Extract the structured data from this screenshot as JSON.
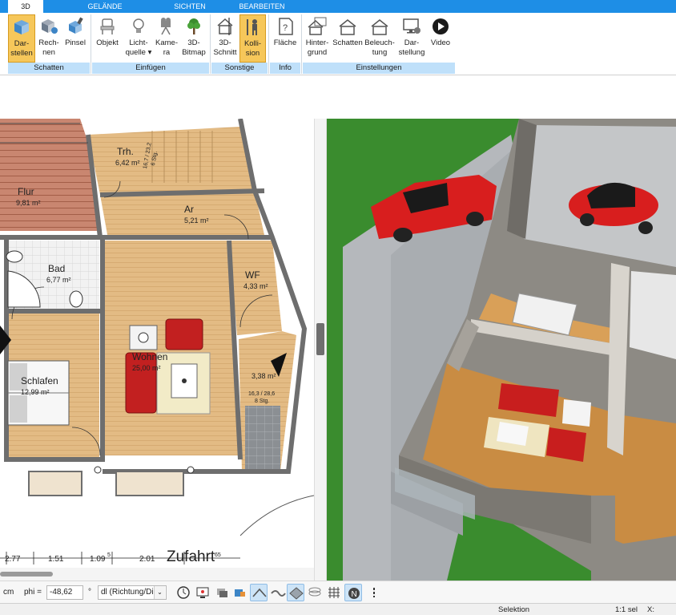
{
  "tabs": [
    {
      "label": "3D",
      "active": true
    },
    {
      "label": "GELÄNDE",
      "active": false
    },
    {
      "label": "SICHTEN",
      "active": false
    },
    {
      "label": "BEARBEITEN",
      "active": false
    }
  ],
  "ribbon": {
    "buttons": [
      {
        "line1": "Dar-",
        "line2": "stellen",
        "icon": "cube-render-icon",
        "active": true
      },
      {
        "line1": "Rech-",
        "line2": "nen",
        "icon": "cube-calc-icon",
        "active": false
      },
      {
        "line1": "Pinsel",
        "line2": "",
        "icon": "brush-cube-icon",
        "active": false
      },
      {
        "line1": "Objekt",
        "line2": "",
        "icon": "chair-icon",
        "active": false
      },
      {
        "line1": "Licht-",
        "line2": "quelle ▾",
        "icon": "lightbulb-icon",
        "active": false
      },
      {
        "line1": "Kame-",
        "line2": "ra",
        "icon": "camera-icon",
        "active": false
      },
      {
        "line1": "3D-",
        "line2": "Bitmap",
        "icon": "tree-icon",
        "active": false
      },
      {
        "line1": "3D-",
        "line2": "Schnitt",
        "icon": "section-house-icon",
        "active": false
      },
      {
        "line1": "Kolli-",
        "line2": "sion",
        "icon": "collision-person-icon",
        "active": true
      },
      {
        "line1": "Fläche",
        "line2": "",
        "icon": "area-info-icon",
        "active": false
      },
      {
        "line1": "Hinter-",
        "line2": "grund",
        "icon": "background-house-icon",
        "active": false
      },
      {
        "line1": "Schatten",
        "line2": "",
        "icon": "shadow-house-icon",
        "active": false
      },
      {
        "line1": "Beleuch-",
        "line2": "tung",
        "icon": "lighting-house-icon",
        "active": false
      },
      {
        "line1": "Dar-",
        "line2": "stellung",
        "icon": "display-monitor-icon",
        "active": false
      },
      {
        "line1": "Video",
        "line2": "",
        "icon": "play-circle-icon",
        "active": false
      }
    ],
    "groups": [
      "Schatten",
      "Einfügen",
      "Sonstige",
      "Info",
      "Einstellungen"
    ]
  },
  "plan": {
    "rooms": [
      {
        "name": "Trh.",
        "area": "6,42 m²"
      },
      {
        "name": "Flur",
        "area": "9,81 m²"
      },
      {
        "name": "Ar",
        "area": "5,21 m²"
      },
      {
        "name": "Bad",
        "area": "6,77 m²"
      },
      {
        "name": "WF",
        "area": "4,33 m²"
      },
      {
        "name": "Wohnen",
        "area": "25,00 m²"
      },
      {
        "name": "Schlafen",
        "area": "12,99 m²"
      },
      {
        "name": "",
        "area": "3,38 m²"
      }
    ],
    "stair_note1": "16,7 / 23,2",
    "stair_note1b": "6 Stg.",
    "stair_note2": "16,3 / 28,6",
    "stair_note2b": "8 Stg.",
    "dimensions": [
      "2.77",
      "1.51",
      "1.09",
      "2.01"
    ],
    "dim_sup1": "5",
    "dim_sup2": "65",
    "street_label": "Zufahrt"
  },
  "inputbar": {
    "unit": "cm",
    "phi_label": "phi =",
    "phi_value": "-48,62",
    "phi_unit": "°",
    "mode_value": "dl (Richtung/Di"
  },
  "statusbar": {
    "mode": "Selektion",
    "scale": "1:1 sel",
    "x_label": "X:"
  },
  "colors": {
    "tab_blue": "#1e8ee6",
    "group_blue": "#bfe0fa",
    "active_button": "#f6c75a",
    "grass": "#3a8c2e",
    "car_red": "#d81e1e"
  }
}
